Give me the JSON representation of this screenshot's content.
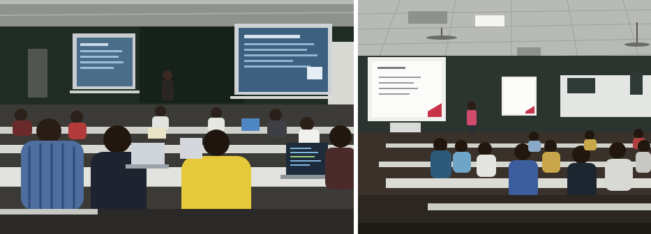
{
  "photos": [
    {
      "subject": "classroom-left"
    },
    {
      "subject": "classroom-right"
    }
  ]
}
